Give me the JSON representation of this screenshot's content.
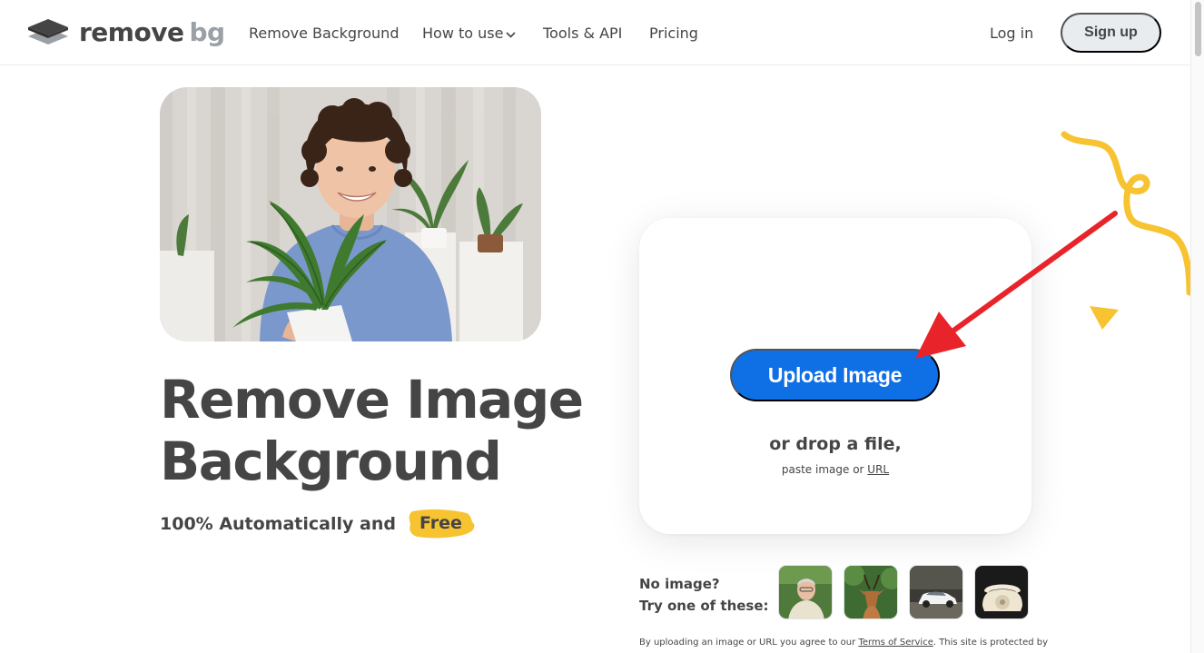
{
  "header": {
    "logo": {
      "word1": "remove",
      "word2": "bg"
    },
    "nav": [
      {
        "label": "Remove Background"
      },
      {
        "label": "How to use",
        "chevron": "chevron-down-icon"
      },
      {
        "label": "Tools & API"
      },
      {
        "label": "Pricing"
      }
    ],
    "login_label": "Log in",
    "signup_label": "Sign up"
  },
  "hero": {
    "headline_line1": "Remove Image",
    "headline_line2": "Background",
    "subline_prefix": "100% Automatically and",
    "subline_free": "Free"
  },
  "upload": {
    "button_label": "Upload Image",
    "drop_text": "or drop a file,",
    "paste_prefix": "paste image or",
    "url_link": "URL"
  },
  "samples": {
    "line1": "No image?",
    "line2": "Try one of these:",
    "thumbnails": [
      "sample-man-icon",
      "sample-antelope-icon",
      "sample-car-icon",
      "sample-telephone-icon"
    ]
  },
  "terms": {
    "prefix": "By uploading an image or URL you agree to our",
    "link": "Terms of Service",
    "suffix": ". This site is protected by"
  },
  "colors": {
    "primary": "#0f70e6",
    "accent_yellow": "#f7c331",
    "arrow_red": "#e8232a",
    "text": "#454545",
    "signup_bg": "#e9ecef"
  }
}
